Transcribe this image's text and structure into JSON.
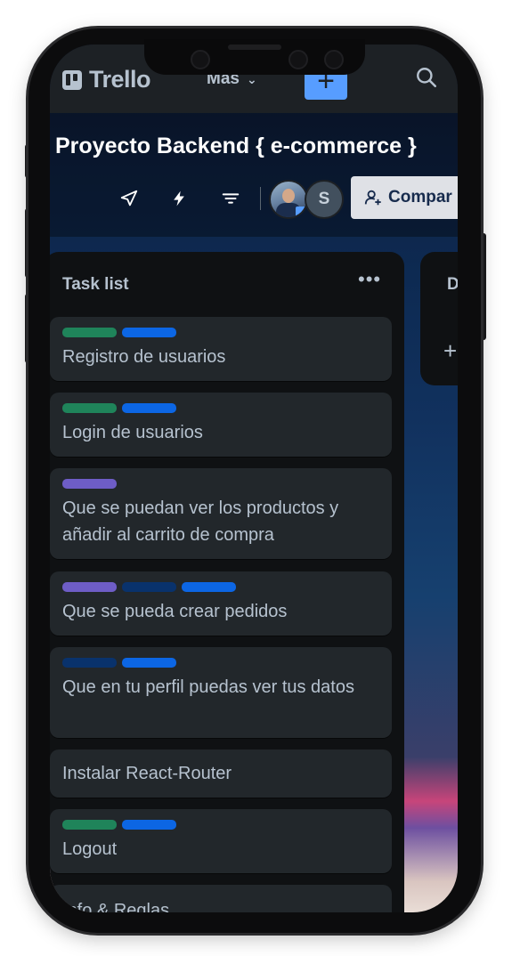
{
  "header": {
    "logo_text": "Trello",
    "more_label": "Mas",
    "create_label": "+"
  },
  "board": {
    "title": "Proyecto Backend { e-commerce }",
    "member_initial": "S",
    "share_label": "Compar"
  },
  "lists": [
    {
      "title": "Task list",
      "menu": "•••",
      "cards": [
        {
          "text": "Registro de usuarios",
          "labels": [
            "#1f845a",
            "#0c66e4"
          ]
        },
        {
          "text": "Login de usuarios",
          "labels": [
            "#1f845a",
            "#0c66e4"
          ]
        },
        {
          "text": "Que se puedan ver los productos y añadir al carrito de compra",
          "labels": [
            "#6e5dc6"
          ]
        },
        {
          "text": "Que se pueda crear pedidos",
          "labels": [
            "#6e5dc6",
            "#09326c",
            "#0c66e4"
          ]
        },
        {
          "text": "Que en tu perfil puedas ver tus datos",
          "labels": [
            "#09326c",
            "#0c66e4"
          ]
        },
        {
          "text": "Instalar React-Router",
          "labels": []
        },
        {
          "text": "Logout",
          "labels": [
            "#1f845a",
            "#0c66e4"
          ]
        },
        {
          "text": "Info & Reglas",
          "labels": []
        }
      ]
    },
    {
      "title": "D",
      "add_label": "+"
    }
  ]
}
